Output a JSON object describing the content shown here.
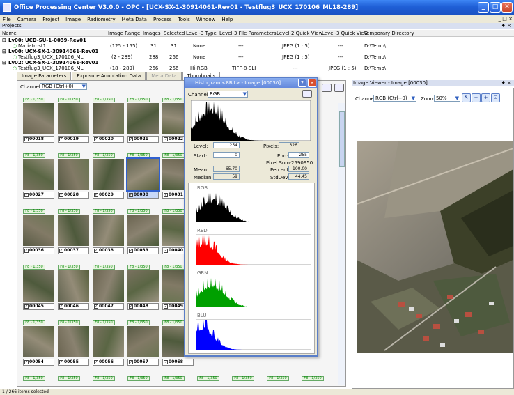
{
  "window": {
    "title": "Office Processing Center V3.0.0 - OPC - [UCX-SX-1-30914061-Rev01 - Testflug3_UCX_170106_ML18-289]",
    "min": "_",
    "max": "□",
    "close": "✕"
  },
  "menu": [
    "File",
    "Camera",
    "Project",
    "Image",
    "Radiometry",
    "Meta Data",
    "Process",
    "Tools",
    "Window",
    "Help"
  ],
  "mdi_controls": "_ □ ×",
  "projects": {
    "title": "Projects",
    "pin": "♦ ×",
    "headers": [
      "Name",
      "Image Range",
      "Images",
      "Selected",
      "Level-3 Type",
      "Level-3 File Parameters",
      "Level-2 Quick View",
      "Level-3 Quick View",
      "Temporary Directory"
    ],
    "rows": [
      {
        "name": "Lv00: UCD-SU-1-0039-Rev01",
        "bold": true
      },
      {
        "name": "Mariatrost1",
        "range": "(125 - 155)",
        "images": "31",
        "selected": "31",
        "type": "None",
        "params": "---",
        "qv2": "JPEG (1 : 5)",
        "qv3": "---",
        "dir": "D:\\Temp\\"
      },
      {
        "name": "Lv00: UCX-SX-1-30914061-Rev01",
        "bold": true
      },
      {
        "name": "Testflug3_UCX_170106_ML",
        "range": "(2 - 289)",
        "images": "288",
        "selected": "266",
        "type": "None",
        "params": "---",
        "qv2": "JPEG (1 : 5)",
        "qv3": "---",
        "dir": "D:\\Temp\\"
      },
      {
        "name": "Lv02: UCX-SX-1-30914061-Rev01",
        "bold": true
      },
      {
        "name": "Testflug3_UCX_170106_ML",
        "range": "(18 - 289)",
        "images": "266",
        "selected": "266",
        "type": "Hi-RGB",
        "params": "TIFF-8-SLI",
        "qv2": "---",
        "qv3": "JPEG (1 : 5)",
        "dir": "D:\\Temp\\"
      }
    ]
  },
  "left": {
    "tabs": [
      "Image Parameters",
      "Exposure Annotation Data",
      "Meta Data",
      "Thumbnails"
    ],
    "channel_label": "Channel:",
    "channel_value": "RGB  (Ctrl+0)",
    "thumb_label": "F8 - 1/350",
    "rows": [
      [
        "00018",
        "00019",
        "00020",
        "00021",
        "00022"
      ],
      [
        "00027",
        "00028",
        "00029",
        "00030",
        "00031"
      ],
      [
        "00036",
        "00037",
        "00038",
        "00039",
        "00040"
      ],
      [
        "00045",
        "00046",
        "00047",
        "00048",
        "00049"
      ],
      [
        "00054",
        "00055",
        "00056",
        "00057",
        "00058"
      ]
    ],
    "selected": "00030"
  },
  "histogram": {
    "title": "Histogram <8Bit> - Image [00030]",
    "help": "?",
    "close": "✕",
    "channel_label": "Channel:",
    "channel_value": "RGB",
    "level_label": "Level:",
    "level": "254",
    "pixels_label": "Pixels:",
    "pixels": "326",
    "start_label": "Start:",
    "start": "0",
    "end_label": "End:",
    "end": "255",
    "pixelsum_label": "Pixel Sum:",
    "pixelsum": "2590950",
    "mean_label": "Mean:",
    "mean": "65.70",
    "percent_label": "Percent:",
    "percent": "100.00",
    "median_label": "Median:",
    "median": "59",
    "stddev_label": "StdDev.:",
    "stddev": "44.45",
    "channels": [
      "RGB",
      "RED",
      "GRN",
      "BLU"
    ],
    "colors": {
      "RGB": "#000000",
      "RED": "#ff0000",
      "GRN": "#00a000",
      "BLU": "#0000ff"
    }
  },
  "viewer": {
    "title": "Image Viewer - Image [00030]",
    "pin": "♦ ×",
    "channel_label": "Channel:",
    "channel_value": "RGB  (Ctrl+0)",
    "zoom_label": "Zoom:",
    "zoom_value": "50%"
  },
  "status": "1 / 266 items selected"
}
